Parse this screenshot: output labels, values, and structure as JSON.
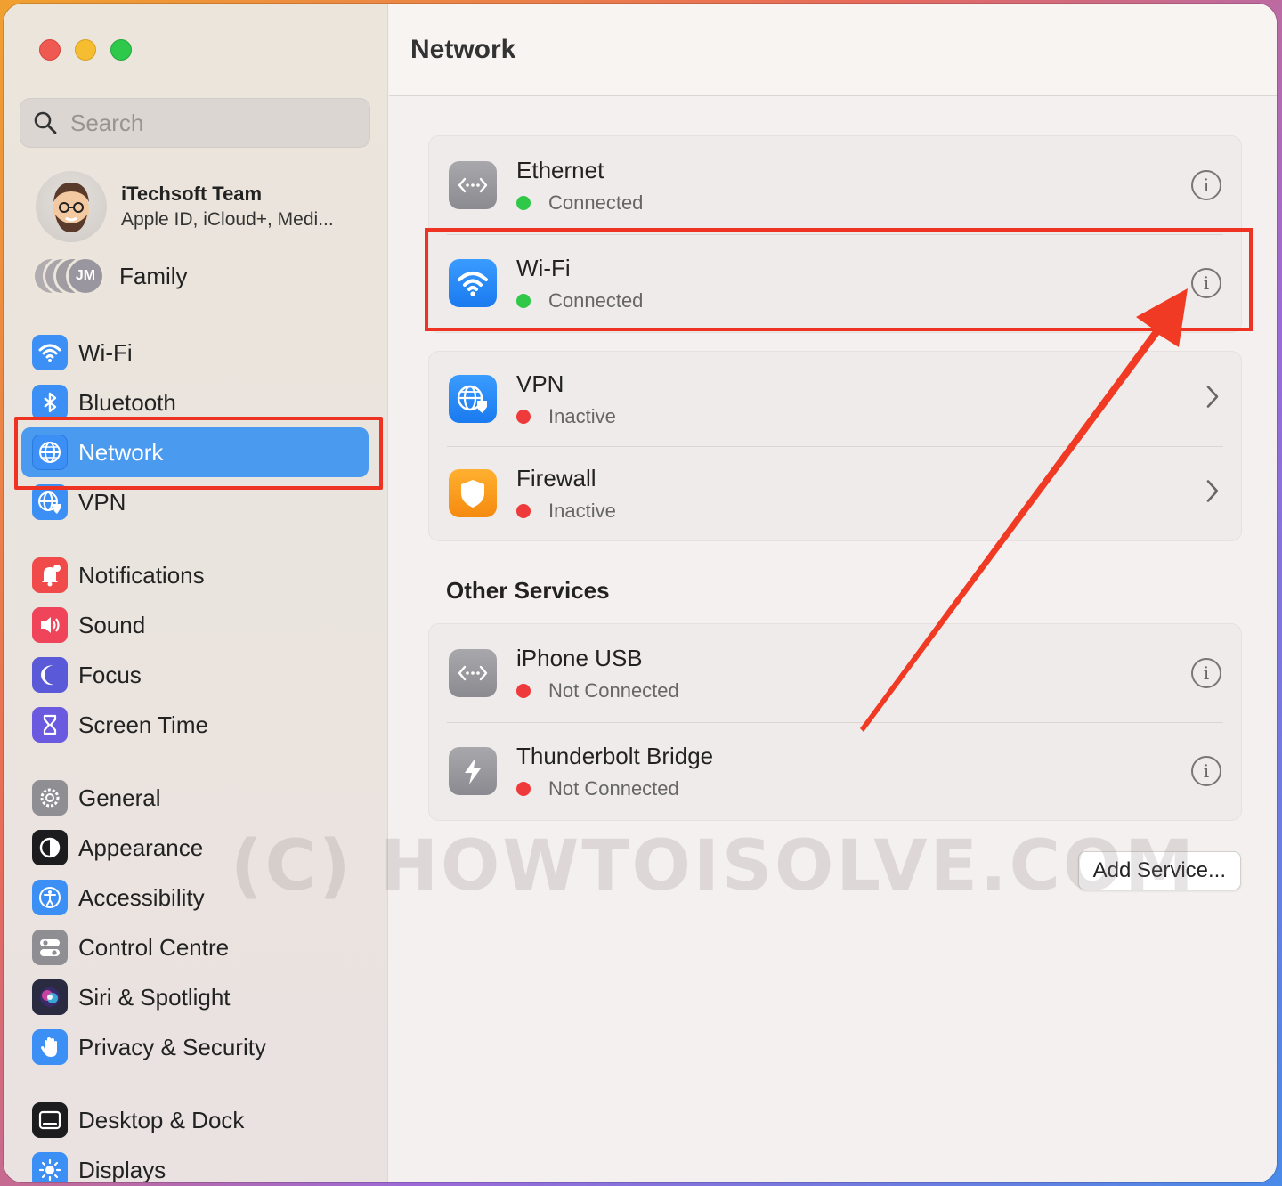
{
  "window": {
    "title": "Network"
  },
  "search": {
    "placeholder": "Search"
  },
  "account": {
    "name": "iTechsoft Team",
    "subtitle": "Apple ID, iCloud+, Medi..."
  },
  "family": {
    "label": "Family",
    "initials": "JM"
  },
  "sidebar": {
    "items": [
      {
        "label": "Wi-Fi",
        "icon": "wifi-icon",
        "color": "#3b8ff5"
      },
      {
        "label": "Bluetooth",
        "icon": "bluetooth-icon",
        "color": "#3b8ff5"
      },
      {
        "label": "Network",
        "icon": "globe-icon",
        "color": "#3b8ff5",
        "selected": true
      },
      {
        "label": "VPN",
        "icon": "vpn-globe-icon",
        "color": "#3b8ff5"
      },
      {
        "label": "Notifications",
        "icon": "bell-icon",
        "color": "#f04a4a"
      },
      {
        "label": "Sound",
        "icon": "speaker-icon",
        "color": "#f0445a"
      },
      {
        "label": "Focus",
        "icon": "moon-icon",
        "color": "#5a5ad8"
      },
      {
        "label": "Screen Time",
        "icon": "hourglass-icon",
        "color": "#6a5ae0"
      },
      {
        "label": "General",
        "icon": "gear-icon",
        "color": "#8e8e93"
      },
      {
        "label": "Appearance",
        "icon": "appearance-icon",
        "color": "#1c1c1e"
      },
      {
        "label": "Accessibility",
        "icon": "accessibility-icon",
        "color": "#3b8ff5"
      },
      {
        "label": "Control Centre",
        "icon": "toggles-icon",
        "color": "#8e8e93"
      },
      {
        "label": "Siri & Spotlight",
        "icon": "siri-icon",
        "color": "#2a2a40"
      },
      {
        "label": "Privacy & Security",
        "icon": "hand-icon",
        "color": "#3b8ff5"
      },
      {
        "label": "Desktop & Dock",
        "icon": "dock-icon",
        "color": "#1c1c1e"
      },
      {
        "label": "Displays",
        "icon": "sun-icon",
        "color": "#3b8ff5"
      }
    ]
  },
  "services": [
    {
      "name": "Ethernet",
      "status": "Connected",
      "status_color": "#30c848",
      "icon": "ethernet-icon",
      "action": "info"
    },
    {
      "name": "Wi-Fi",
      "status": "Connected",
      "status_color": "#30c848",
      "icon": "wifi-icon",
      "action": "info"
    },
    {
      "name": "VPN",
      "status": "Inactive",
      "status_color": "#ee3a3a",
      "icon": "vpn-globe-icon",
      "action": "chevron"
    },
    {
      "name": "Firewall",
      "status": "Inactive",
      "status_color": "#ee3a3a",
      "icon": "shield-icon",
      "action": "chevron"
    }
  ],
  "other_services": {
    "title": "Other Services",
    "items": [
      {
        "name": "iPhone USB",
        "status": "Not Connected",
        "status_color": "#ee3a3a",
        "icon": "ethernet-icon",
        "action": "info"
      },
      {
        "name": "Thunderbolt Bridge",
        "status": "Not Connected",
        "status_color": "#ee3a3a",
        "icon": "thunderbolt-icon",
        "action": "info"
      }
    ]
  },
  "add_service_label": "Add Service...",
  "info_glyph": "i",
  "watermark": "(C) HOWTOISOLVE.COM"
}
